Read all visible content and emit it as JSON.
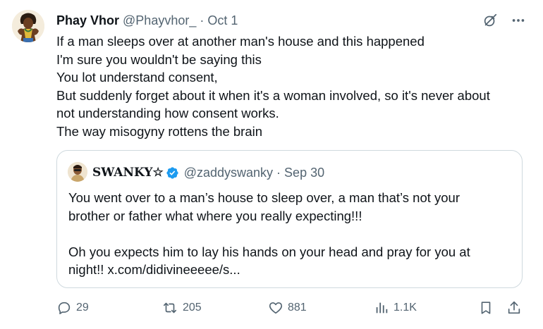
{
  "author": {
    "name": "Phay Vhor",
    "handle": "@Phayvhor_",
    "separator": "·",
    "date": "Oct 1"
  },
  "tweet_lines": [
    "If a man sleeps over at another man's house and this happened",
    "I'm sure you wouldn't be saying this",
    "You lot understand consent,",
    "But suddenly forget about it when it's a woman involved, so it's never about",
    "not understanding how consent works.",
    "The way misogyny rottens the brain"
  ],
  "quote": {
    "name": "SWANKY☆",
    "verified": true,
    "handle": "@zaddyswanky",
    "separator": "·",
    "date": "Sep 30",
    "lines": [
      "You went over to a man’s house to sleep over, a man that’s not your",
      "brother or father  what where you really expecting!!!",
      "",
      "Oh you expects him to lay his hands on your head and pray for you at",
      "night!! x.com/didivineeeee/s..."
    ]
  },
  "actions": {
    "reply_count": "29",
    "retweet_count": "205",
    "like_count": "881",
    "views_count": "1.1K"
  },
  "icons": {
    "top": [
      "grok-icon",
      "more-icon"
    ],
    "actions": [
      "reply-icon",
      "retweet-icon",
      "like-icon",
      "views-icon",
      "bookmark-icon",
      "share-icon"
    ]
  },
  "colors": {
    "text": "#0f1419",
    "secondary": "#536471",
    "border": "#cfd9de",
    "verified": "#1d9bf0"
  }
}
